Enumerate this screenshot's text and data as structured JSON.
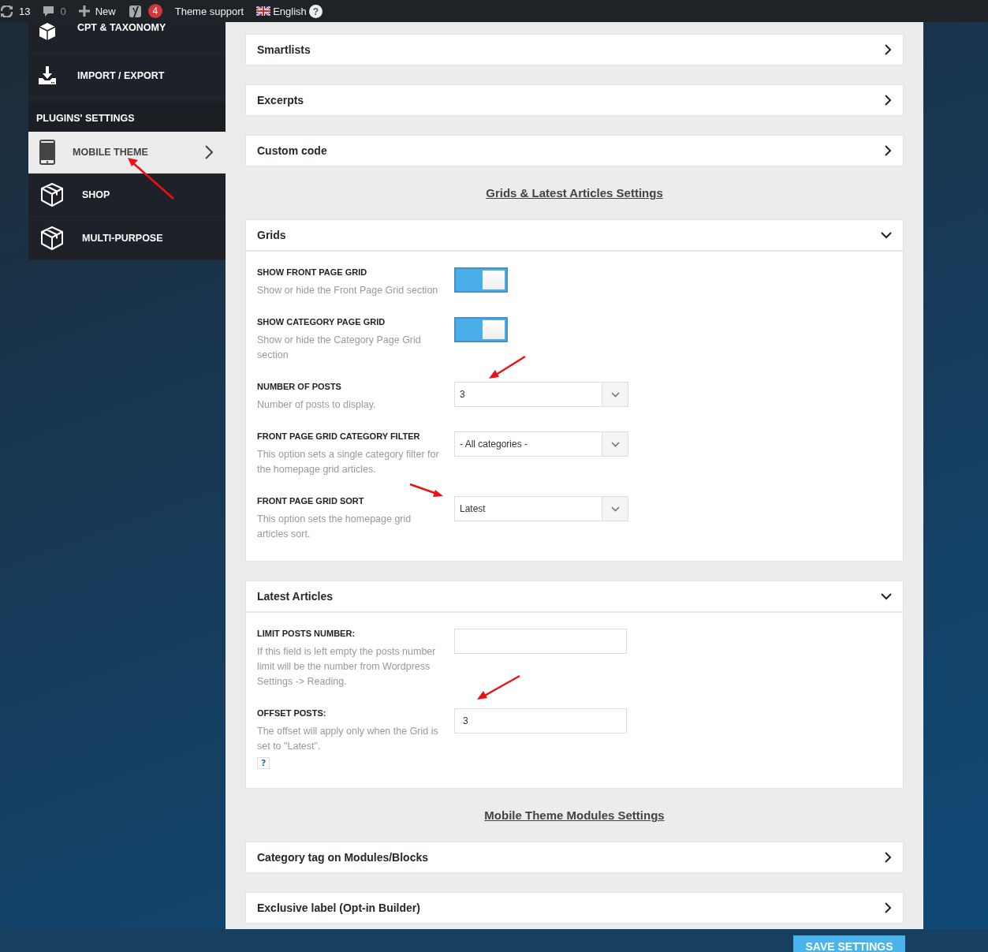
{
  "admin_bar": {
    "updates_count": "13",
    "comments_count": "0",
    "new_label": "New",
    "seo_badge": "4",
    "theme_support": "Theme support",
    "language": "English",
    "help_icon": "?"
  },
  "sidebar": {
    "items": [
      {
        "label": "CPT & TAXONOMY",
        "kind": "cube"
      },
      {
        "label": "IMPORT / EXPORT",
        "kind": "download"
      }
    ],
    "section_title": "PLUGINS' SETTINGS",
    "plugin_items": [
      {
        "label": "MOBILE THEME",
        "kind": "phone",
        "selected": true
      },
      {
        "label": "SHOP",
        "kind": "box",
        "selected": false
      },
      {
        "label": "MULTI-PURPOSE",
        "kind": "box",
        "selected": false
      }
    ]
  },
  "sections": [
    {
      "kind": "accordion",
      "title": "Smartlists",
      "expanded": false
    },
    {
      "kind": "accordion",
      "title": "Excerpts",
      "expanded": false
    },
    {
      "kind": "accordion",
      "title": "Custom code",
      "expanded": false
    },
    {
      "kind": "heading",
      "text": "Grids & Latest Articles Settings"
    },
    {
      "kind": "accordion",
      "title": "Grids",
      "expanded": true,
      "fields": [
        {
          "kind": "toggle",
          "label": "SHOW FRONT PAGE GRID",
          "description": "Show or hide the Front Page Grid section",
          "on": true
        },
        {
          "kind": "toggle",
          "label": "SHOW CATEGORY PAGE GRID",
          "description": "Show or hide the Category Page Grid section",
          "on": true
        },
        {
          "kind": "select",
          "label": "NUMBER OF POSTS",
          "description": "Number of posts to display.",
          "value": "3"
        },
        {
          "kind": "select",
          "label": "FRONT PAGE GRID CATEGORY FILTER",
          "description": "This option sets a single category filter for the homepage grid articles.",
          "value": "- All categories -"
        },
        {
          "kind": "select",
          "label": "FRONT PAGE GRID SORT",
          "description": "This option sets the homepage grid articles sort.",
          "value": "Latest"
        }
      ]
    },
    {
      "kind": "accordion",
      "title": "Latest Articles",
      "expanded": true,
      "fields": [
        {
          "kind": "input",
          "label": "LIMIT POSTS NUMBER:",
          "description": "If this field is left empty the posts number limit will be the number from Wordpress Settings -> Reading."
        },
        {
          "kind": "input",
          "label": "OFFSET POSTS:",
          "description": "The offset will apply only when the Grid is set to \"Latest\".",
          "value": "3",
          "help": "?"
        }
      ]
    },
    {
      "kind": "heading",
      "text": "Mobile Theme Modules Settings"
    },
    {
      "kind": "accordion",
      "title": "Category tag on Modules/Blocks",
      "expanded": false
    },
    {
      "kind": "accordion",
      "title": "Exclusive label (Opt-in Builder)",
      "expanded": false
    }
  ],
  "save_button": "SAVE SETTINGS"
}
